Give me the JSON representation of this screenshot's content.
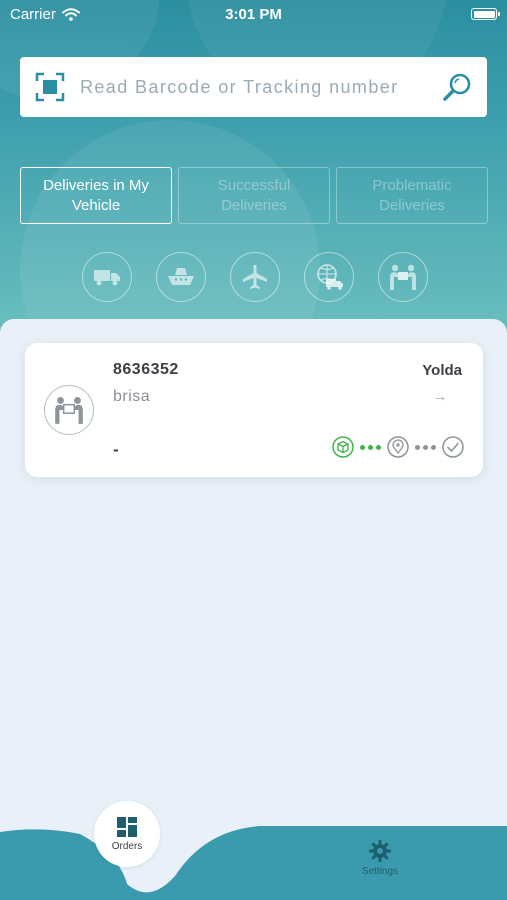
{
  "status_bar": {
    "carrier": "Carrier",
    "time": "3:01 PM"
  },
  "search": {
    "placeholder": "Read Barcode or Tracking number",
    "value": ""
  },
  "tabs": [
    {
      "label": "Deliveries in My Vehicle",
      "active": true
    },
    {
      "label": "Successful Deliveries",
      "active": false
    },
    {
      "label": "Problematic Deliveries",
      "active": false
    }
  ],
  "filters": [
    {
      "icon": "truck-icon"
    },
    {
      "icon": "ship-icon"
    },
    {
      "icon": "airplane-icon"
    },
    {
      "icon": "global-delivery-icon"
    },
    {
      "icon": "hand-delivery-icon"
    }
  ],
  "deliveries": [
    {
      "order_no": "8636352",
      "customer": "brisa",
      "company": "Yolda",
      "arrow": "→",
      "address": "-",
      "status_steps": [
        "package-icon",
        "location-pin-icon",
        "check-icon"
      ]
    }
  ],
  "tabbar": {
    "orders_label": "Orders",
    "settings_label": "Settings"
  },
  "colors": {
    "primary": "#2c8fa0",
    "tabbar": "#3a9aae",
    "green": "#43b24a",
    "text_dark": "#3c4045"
  }
}
